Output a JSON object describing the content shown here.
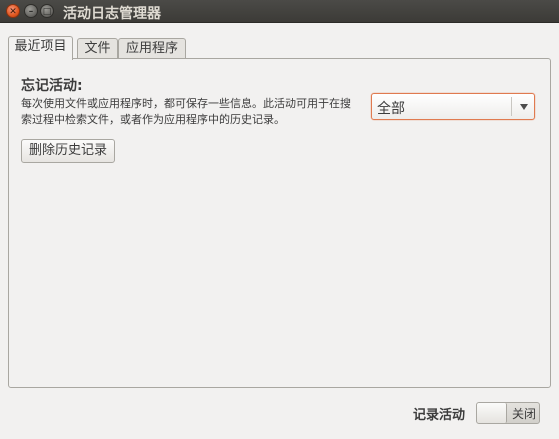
{
  "window": {
    "title": "活动日志管理器",
    "close_glyph": "✕",
    "min_glyph": "–",
    "max_glyph": "□"
  },
  "tabs": [
    {
      "label": "最近项目",
      "active": true
    },
    {
      "label": "文件",
      "active": false
    },
    {
      "label": "应用程序",
      "active": false
    }
  ],
  "recent": {
    "forget_title": "忘记活动:",
    "forget_description": "每次使用文件或应用程序时，都可保存一些信息。此活动可用于在搜索过程中检索文件，或者作为应用程序中的历史记录。",
    "timespan_selected": "全部",
    "clear_history_label": "删除历史记录"
  },
  "footer": {
    "record_label": "记录活动",
    "toggle_state": "关闭"
  },
  "colors": {
    "titlebar": "#3c3b37",
    "close_button": "#e0571f",
    "focus_border": "#e07a4f",
    "window_bg": "#f2f1f0"
  }
}
